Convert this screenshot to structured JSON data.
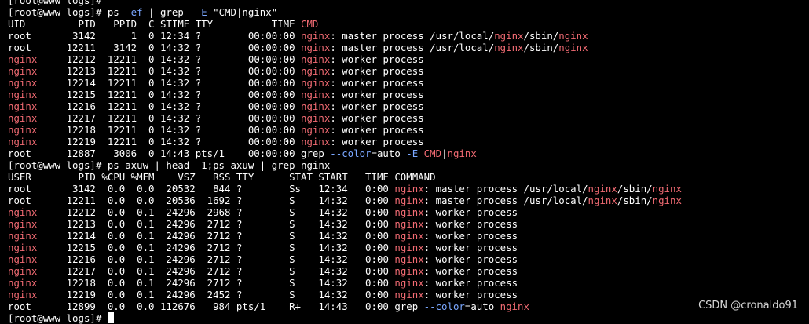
{
  "colors": {
    "background": "#000000",
    "foreground": "#ffffff",
    "highlight": "#f26b73",
    "option": "#7aa7ff",
    "watermark": "#d8d8d8"
  },
  "terminal": {
    "lines": [
      [
        {
          "t": "[root@www logs]# "
        }
      ],
      [
        {
          "t": "[root@www logs]# ps "
        },
        {
          "t": "-ef",
          "c": "opt"
        },
        {
          "t": " | grep  "
        },
        {
          "t": "-E",
          "c": "opt"
        },
        {
          "t": " \"CMD|nginx\""
        }
      ],
      [
        {
          "t": "UID         PID   PPID  C STIME TTY          TIME "
        },
        {
          "t": "CMD",
          "c": "hl"
        }
      ],
      [
        {
          "t": "root       3142      1  0 12:34 ?        00:00:00 "
        },
        {
          "t": "nginx",
          "c": "hl"
        },
        {
          "t": ": master process /usr/local/"
        },
        {
          "t": "nginx",
          "c": "hl"
        },
        {
          "t": "/sbin/"
        },
        {
          "t": "nginx",
          "c": "hl"
        }
      ],
      [
        {
          "t": "root      12211   3142  0 14:32 ?        00:00:00 "
        },
        {
          "t": "nginx",
          "c": "hl"
        },
        {
          "t": ": master process /usr/local/"
        },
        {
          "t": "nginx",
          "c": "hl"
        },
        {
          "t": "/sbin/"
        },
        {
          "t": "nginx",
          "c": "hl"
        }
      ],
      [
        {
          "t": "nginx",
          "c": "hl"
        },
        {
          "t": "     12212  12211  0 14:32 ?        00:00:00 "
        },
        {
          "t": "nginx",
          "c": "hl"
        },
        {
          "t": ": worker process"
        }
      ],
      [
        {
          "t": "nginx",
          "c": "hl"
        },
        {
          "t": "     12213  12211  0 14:32 ?        00:00:00 "
        },
        {
          "t": "nginx",
          "c": "hl"
        },
        {
          "t": ": worker process"
        }
      ],
      [
        {
          "t": "nginx",
          "c": "hl"
        },
        {
          "t": "     12214  12211  0 14:32 ?        00:00:00 "
        },
        {
          "t": "nginx",
          "c": "hl"
        },
        {
          "t": ": worker process"
        }
      ],
      [
        {
          "t": "nginx",
          "c": "hl"
        },
        {
          "t": "     12215  12211  0 14:32 ?        00:00:00 "
        },
        {
          "t": "nginx",
          "c": "hl"
        },
        {
          "t": ": worker process"
        }
      ],
      [
        {
          "t": "nginx",
          "c": "hl"
        },
        {
          "t": "     12216  12211  0 14:32 ?        00:00:00 "
        },
        {
          "t": "nginx",
          "c": "hl"
        },
        {
          "t": ": worker process"
        }
      ],
      [
        {
          "t": "nginx",
          "c": "hl"
        },
        {
          "t": "     12217  12211  0 14:32 ?        00:00:00 "
        },
        {
          "t": "nginx",
          "c": "hl"
        },
        {
          "t": ": worker process"
        }
      ],
      [
        {
          "t": "nginx",
          "c": "hl"
        },
        {
          "t": "     12218  12211  0 14:32 ?        00:00:00 "
        },
        {
          "t": "nginx",
          "c": "hl"
        },
        {
          "t": ": worker process"
        }
      ],
      [
        {
          "t": "nginx",
          "c": "hl"
        },
        {
          "t": "     12219  12211  0 14:32 ?        00:00:00 "
        },
        {
          "t": "nginx",
          "c": "hl"
        },
        {
          "t": ": worker process"
        }
      ],
      [
        {
          "t": "root      12887   3006  0 14:43 pts/1    00:00:00 grep "
        },
        {
          "t": "--color",
          "c": "opt"
        },
        {
          "t": "=auto "
        },
        {
          "t": "-E",
          "c": "opt"
        },
        {
          "t": " "
        },
        {
          "t": "CMD",
          "c": "hl"
        },
        {
          "t": "|"
        },
        {
          "t": "nginx",
          "c": "hl"
        }
      ],
      [
        {
          "t": "[root@www logs]# ps axuw | head -1;ps axuw | grep nginx"
        }
      ],
      [
        {
          "t": "USER        PID %CPU %MEM    VSZ   RSS TTY      STAT START   TIME COMMAND"
        }
      ],
      [
        {
          "t": "root       3142  0.0  0.0  20532   844 ?        Ss   12:34   0:00 "
        },
        {
          "t": "nginx",
          "c": "hl"
        },
        {
          "t": ": master process /usr/local/"
        },
        {
          "t": "nginx",
          "c": "hl"
        },
        {
          "t": "/sbin/"
        },
        {
          "t": "nginx",
          "c": "hl"
        }
      ],
      [
        {
          "t": "root      12211  0.0  0.0  20536  1692 ?        S    14:32   0:00 "
        },
        {
          "t": "nginx",
          "c": "hl"
        },
        {
          "t": ": master process /usr/local/"
        },
        {
          "t": "nginx",
          "c": "hl"
        },
        {
          "t": "/sbin/"
        },
        {
          "t": "nginx",
          "c": "hl"
        }
      ],
      [
        {
          "t": "nginx",
          "c": "hl"
        },
        {
          "t": "     12212  0.0  0.1  24296  2968 ?        S    14:32   0:00 "
        },
        {
          "t": "nginx",
          "c": "hl"
        },
        {
          "t": ": worker process"
        }
      ],
      [
        {
          "t": "nginx",
          "c": "hl"
        },
        {
          "t": "     12213  0.0  0.1  24296  2712 ?        S    14:32   0:00 "
        },
        {
          "t": "nginx",
          "c": "hl"
        },
        {
          "t": ": worker process"
        }
      ],
      [
        {
          "t": "nginx",
          "c": "hl"
        },
        {
          "t": "     12214  0.0  0.1  24296  2712 ?        S    14:32   0:00 "
        },
        {
          "t": "nginx",
          "c": "hl"
        },
        {
          "t": ": worker process"
        }
      ],
      [
        {
          "t": "nginx",
          "c": "hl"
        },
        {
          "t": "     12215  0.0  0.1  24296  2712 ?        S    14:32   0:00 "
        },
        {
          "t": "nginx",
          "c": "hl"
        },
        {
          "t": ": worker process"
        }
      ],
      [
        {
          "t": "nginx",
          "c": "hl"
        },
        {
          "t": "     12216  0.0  0.1  24296  2712 ?        S    14:32   0:00 "
        },
        {
          "t": "nginx",
          "c": "hl"
        },
        {
          "t": ": worker process"
        }
      ],
      [
        {
          "t": "nginx",
          "c": "hl"
        },
        {
          "t": "     12217  0.0  0.1  24296  2712 ?        S    14:32   0:00 "
        },
        {
          "t": "nginx",
          "c": "hl"
        },
        {
          "t": ": worker process"
        }
      ],
      [
        {
          "t": "nginx",
          "c": "hl"
        },
        {
          "t": "     12218  0.0  0.1  24296  2712 ?        S    14:32   0:00 "
        },
        {
          "t": "nginx",
          "c": "hl"
        },
        {
          "t": ": worker process"
        }
      ],
      [
        {
          "t": "nginx",
          "c": "hl"
        },
        {
          "t": "     12219  0.0  0.1  24296  2452 ?        S    14:32   0:00 "
        },
        {
          "t": "nginx",
          "c": "hl"
        },
        {
          "t": ": worker process"
        }
      ],
      [
        {
          "t": "root      12899  0.0  0.0 112676   984 pts/1    R+   14:43   0:00 grep "
        },
        {
          "t": "--color",
          "c": "opt"
        },
        {
          "t": "=auto "
        },
        {
          "t": "nginx",
          "c": "hl"
        }
      ],
      [
        {
          "t": "[root@www logs]# "
        }
      ]
    ],
    "cursor_line": 27
  },
  "watermark": {
    "text": "CSDN @cronaldo91"
  }
}
